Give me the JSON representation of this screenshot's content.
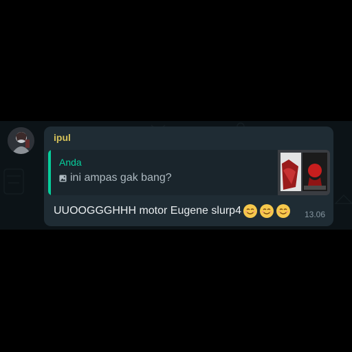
{
  "message": {
    "sender": "ipul",
    "sender_color": "#d6c25a",
    "quote": {
      "author": "Anda",
      "author_color": "#06cf9c",
      "media_icon": "photo-icon",
      "text": "ini ampas gak bang?"
    },
    "text": "UUOOGGGHHH motor Eugene slurp4",
    "emojis": [
      "smiling-face-icon",
      "smiling-face-icon",
      "smiling-face-icon"
    ],
    "time": "13.06"
  },
  "colors": {
    "chat_background": "#0c1317",
    "bubble": "#1f2c34",
    "quote_background": "#1a252c",
    "text": "#e9edef",
    "time": "#8696a0"
  }
}
